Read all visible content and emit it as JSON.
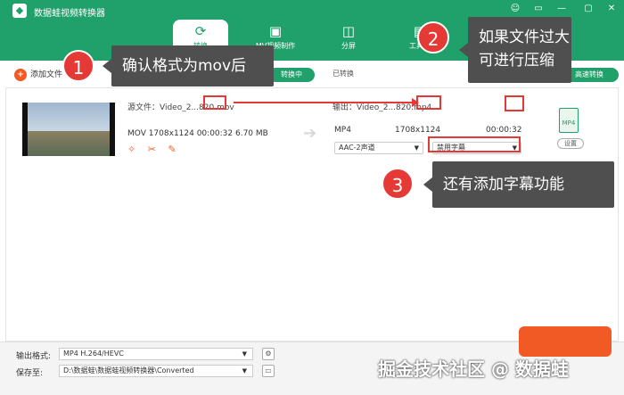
{
  "app": {
    "title": "数据蛙视频转换器"
  },
  "window_controls": [
    "☺",
    "▭",
    "—",
    "▢",
    "✕"
  ],
  "nav": {
    "tabs": [
      {
        "label": "转换",
        "icon": "convert-icon"
      },
      {
        "label": "MV视频制作",
        "icon": "mv-icon"
      },
      {
        "label": "分屏",
        "icon": "splitscreen-icon"
      },
      {
        "label": "工具箱",
        "icon": "toolbox-icon"
      }
    ]
  },
  "toolbar": {
    "add_file": "添加文件",
    "converting": "转换中",
    "converted": "已转换",
    "high_speed": "高速转换"
  },
  "file": {
    "source_label": "源文件：Video_2...820.mov",
    "meta": "MOV  1708x1124  00:00:32  6.70 MB",
    "output_label": "输出：Video_2...820.mp4",
    "out_format": "MP4",
    "out_resolution": "1708x1124",
    "out_duration": "00:00:32",
    "audio": "AAC-2声道",
    "subtitle": "禁用字幕",
    "format_badge": "MP4",
    "settings": "设置"
  },
  "callouts": [
    {
      "num": "1",
      "text": "确认格式为mov后"
    },
    {
      "num": "2",
      "text": "如果文件过大\n可进行压缩"
    },
    {
      "num": "3",
      "text": "还有添加字幕功能"
    }
  ],
  "bottom": {
    "format_label": "输出格式:",
    "format_value": "MP4 H.264/HEVC",
    "save_label": "保存至:",
    "save_path": "D:\\数据蛙\\数据蛙视频转换器\\Converted"
  },
  "watermark": "掘金技术社区 @ 数据蛙",
  "colors": {
    "brand_green": "#20a06a",
    "accent_orange": "#f15a24",
    "annotation_red": "#e53935",
    "callout_gray": "#4f4f4f"
  }
}
